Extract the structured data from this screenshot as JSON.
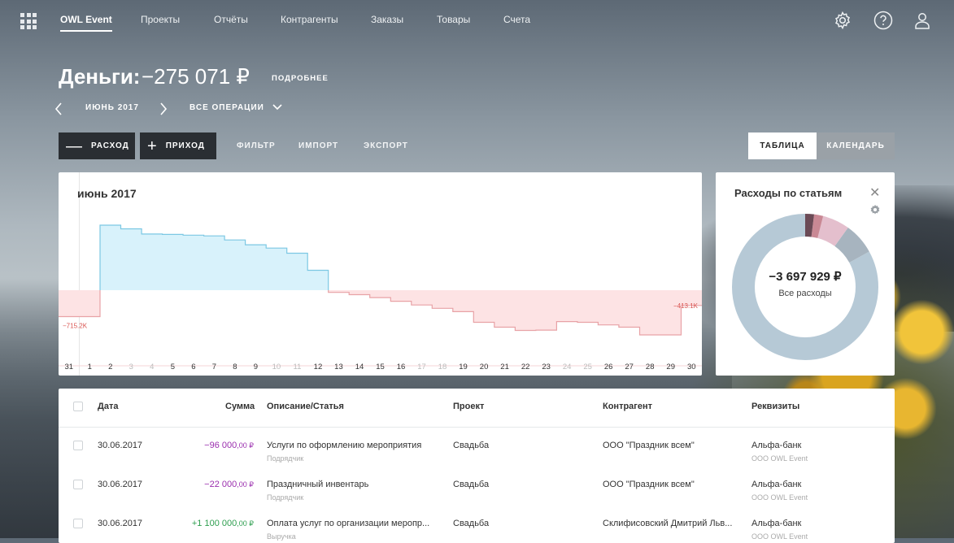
{
  "nav": {
    "items": [
      "OWL Event",
      "Проекты",
      "Отчёты",
      "Контрагенты",
      "Заказы",
      "Товары",
      "Счета"
    ],
    "active_index": 0
  },
  "header": {
    "title": "Деньги:",
    "balance": "−275 071 ₽",
    "more_label": "ПОДРОБНЕЕ",
    "period": "ИЮНЬ 2017",
    "operations_filter": "ВСЕ ОПЕРАЦИИ"
  },
  "toolbar": {
    "expense_label": "РАСХОД",
    "income_label": "ПРИХОД",
    "filter_label": "ФИЛЬТР",
    "import_label": "ИМПОРТ",
    "export_label": "ЭКСПОРТ",
    "view_table_label": "ТАБЛИЦА",
    "view_calendar_label": "КАЛЕНДАРЬ",
    "active_view": "table"
  },
  "chart_data": {
    "type": "area",
    "title": "июнь 2017",
    "x": [
      "31",
      "1",
      "2",
      "3",
      "4",
      "5",
      "6",
      "7",
      "8",
      "9",
      "10",
      "11",
      "12",
      "13",
      "14",
      "15",
      "16",
      "17",
      "18",
      "19",
      "20",
      "21",
      "22",
      "23",
      "24",
      "25",
      "26",
      "27",
      "28",
      "29",
      "30"
    ],
    "dimmed_ticks": [
      "3",
      "4",
      "10",
      "11",
      "17",
      "18",
      "24",
      "25"
    ],
    "values": [
      -715,
      -715,
      1760,
      1660,
      1520,
      1510,
      1490,
      1470,
      1360,
      1230,
      1140,
      1000,
      540,
      -60,
      -120,
      -200,
      -300,
      -400,
      -490,
      -580,
      -870,
      -1000,
      -1090,
      -1080,
      -850,
      -870,
      -940,
      -1000,
      -1210,
      -1210,
      -413
    ],
    "start_label": "−715.2K",
    "end_label": "−413.1K",
    "colors": {
      "positive_fill": "#d8f2fb",
      "positive_line": "#7cc8e3",
      "negative_fill": "#fde3e4",
      "negative_line": "#e8a2a6",
      "label": "#d9534f"
    }
  },
  "expenses_panel": {
    "title": "Расходы по статьям",
    "total": "−3 697 929 ₽",
    "total_label": "Все расходы",
    "segments": [
      {
        "share": 0.83,
        "color": "#b6c9d6"
      },
      {
        "share": 0.07,
        "color": "#a7b4bf"
      },
      {
        "share": 0.06,
        "color": "#e4bfcd"
      },
      {
        "share": 0.02,
        "color": "#c98894"
      },
      {
        "share": 0.02,
        "color": "#6b4a56"
      }
    ]
  },
  "table": {
    "headers": [
      "Дата",
      "Сумма",
      "Описание/Статья",
      "Проект",
      "Контрагент",
      "Реквизиты"
    ],
    "rows": [
      {
        "date": "30.06.2017",
        "amount": "−96 000",
        "cents": ",00 ₽",
        "amount_color": "#9b2fae",
        "description": "Услуги по оформлению мероприятия",
        "category": "Подрядчик",
        "project": "Свадьба",
        "counterparty": "ООО \"Праздник всем\"",
        "account": "Альфа-банк",
        "company": "ООО OWL Event"
      },
      {
        "date": "30.06.2017",
        "amount": "−22 000",
        "cents": ",00 ₽",
        "amount_color": "#9b2fae",
        "description": "Праздничный инвентарь",
        "category": "Подрядчик",
        "project": "Свадьба",
        "counterparty": "ООО \"Праздник всем\"",
        "account": "Альфа-банк",
        "company": "ООО OWL Event"
      },
      {
        "date": "30.06.2017",
        "amount": "+1 100 000",
        "cents": ",00 ₽",
        "amount_color": "#2e9e4f",
        "description": "Оплата услуг по организации меропр...",
        "category": "Выручка",
        "project": "Свадьба",
        "counterparty": "Склифисовский Дмитрий Льв...",
        "account": "Альфа-банк",
        "company": "ООО OWL Event"
      }
    ]
  }
}
